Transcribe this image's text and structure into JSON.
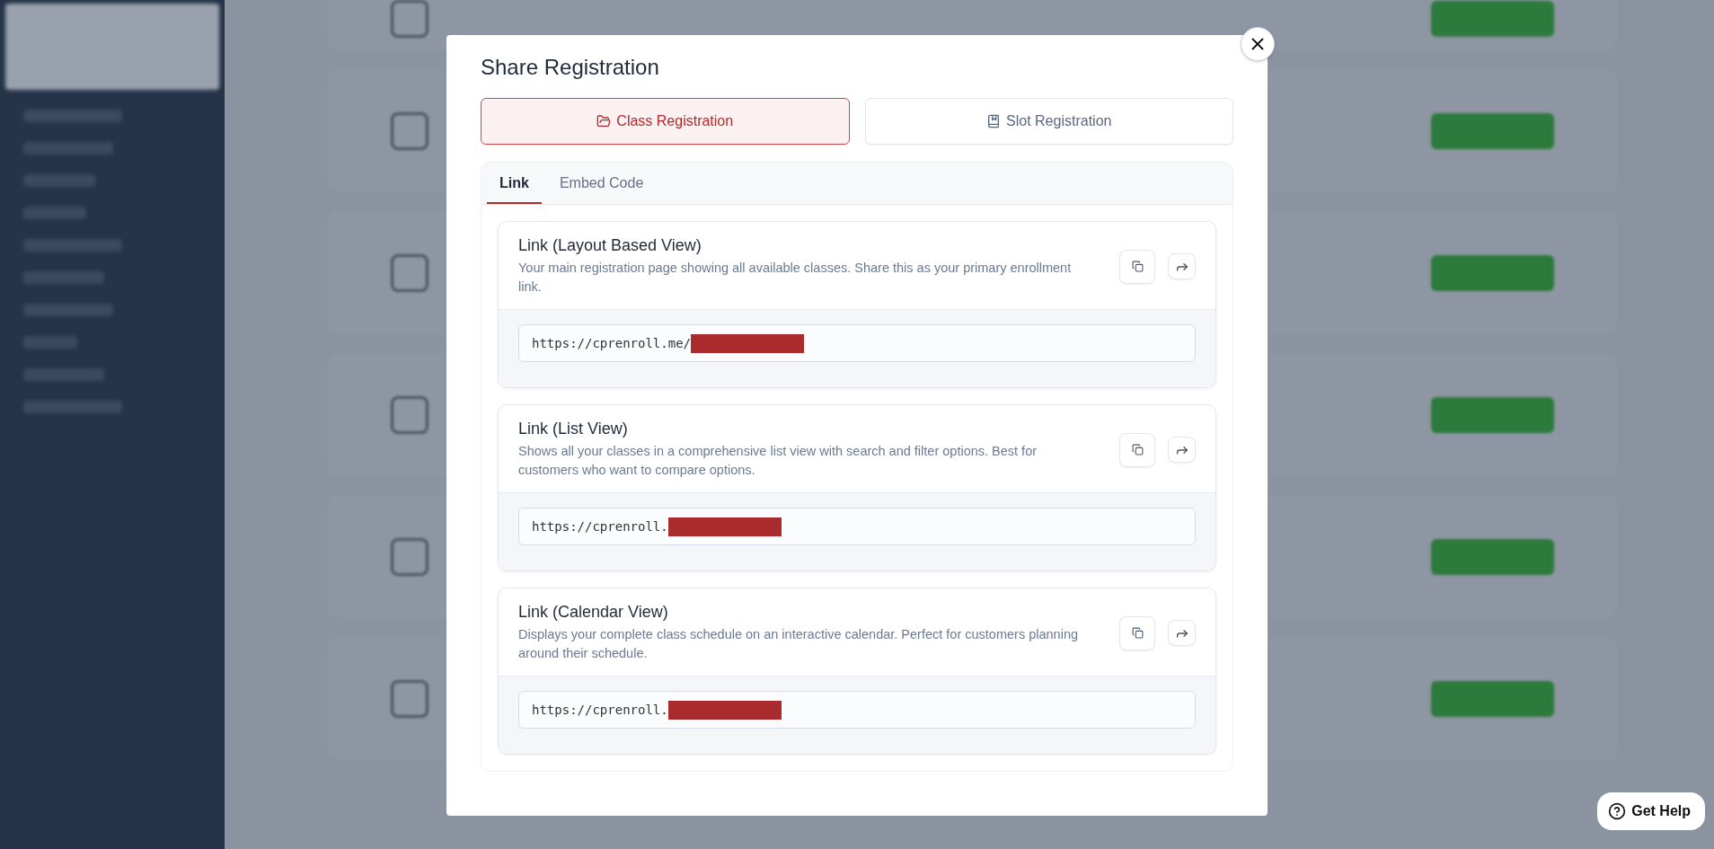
{
  "dialog": {
    "title": "Share Registration"
  },
  "registration_types": [
    {
      "label": "Class Registration",
      "selected": true
    },
    {
      "label": "Slot Registration",
      "selected": false
    }
  ],
  "tabs": [
    {
      "label": "Link",
      "selected": true
    },
    {
      "label": "Embed Code",
      "selected": false
    }
  ],
  "links": [
    {
      "title": "Link (Layout Based View)",
      "description": "Your main registration page showing all available classes. Share this as your primary enrollment link.",
      "url": "https://cprenroll.me/",
      "redacted": true
    },
    {
      "title": "Link (List View)",
      "description": "Shows all your classes in a comprehensive list view with search and filter options. Best for customers who want to compare options.",
      "url": "https://cprenroll.",
      "redacted": true
    },
    {
      "title": "Link (Calendar View)",
      "description": "Displays your complete class schedule on an interactive calendar. Perfect for customers planning around their schedule.",
      "url": "https://cprenroll.",
      "redacted": true
    }
  ],
  "help_button": {
    "label": "Get Help"
  }
}
